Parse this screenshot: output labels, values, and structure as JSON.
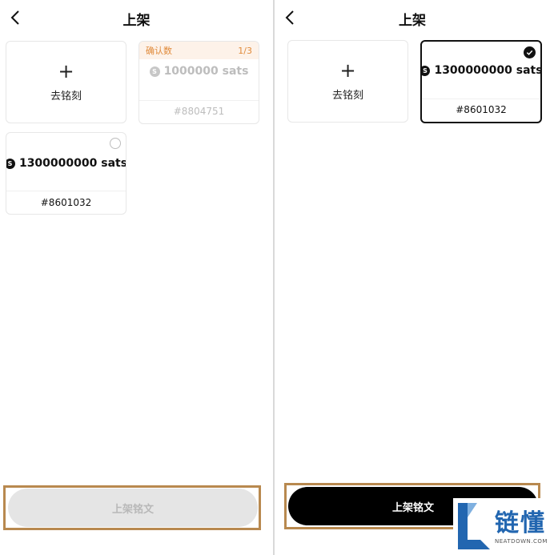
{
  "left_panel": {
    "title": "上架",
    "inscribe_label": "去铭刻",
    "pending_card": {
      "confirm_label": "确认数",
      "confirm_count": "1/3",
      "amount": "1000000 sats",
      "id": "#8804751"
    },
    "listing_card": {
      "amount": "1300000000 sats",
      "id": "#8601032",
      "selected": false
    },
    "list_button_label": "上架铭文",
    "list_button_state": "disabled"
  },
  "right_panel": {
    "title": "上架",
    "inscribe_label": "去铭刻",
    "listing_card": {
      "amount": "1300000000 sats",
      "id": "#8601032",
      "selected": true
    },
    "list_button_label": "上架铭文",
    "list_button_state": "active"
  },
  "coin_symbol": "S",
  "watermark": {
    "text": "链懂",
    "subtext": "NEATDOWN.COM"
  },
  "colors": {
    "accent_dark": "#000000",
    "confirm_orange": "#e08a3a",
    "confirm_bg": "#fdf2e9",
    "highlight_frame": "#b8894f",
    "disabled_bg": "#e5e5e5",
    "watermark_blue": "#2266b0"
  }
}
